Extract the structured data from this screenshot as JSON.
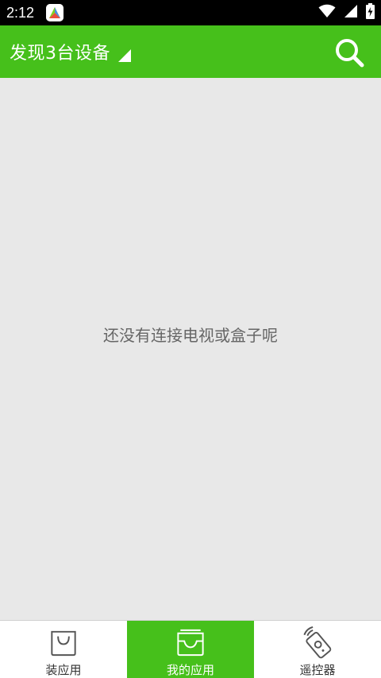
{
  "status_bar": {
    "time": "2:12",
    "icons": [
      "app-notification-icon",
      "wifi-icon",
      "cell-signal-icon",
      "battery-charging-icon"
    ]
  },
  "app_bar": {
    "title": "发现3台设备",
    "dropdown_icon": "triangle-dropdown-icon",
    "search_icon": "search-icon"
  },
  "main": {
    "empty_message": "还没有连接电视或盒子呢"
  },
  "bottom_nav": {
    "items": [
      {
        "label": "装应用",
        "icon": "shopping-bag-icon",
        "active": false
      },
      {
        "label": "我的应用",
        "icon": "inbox-tray-icon",
        "active": true
      },
      {
        "label": "遥控器",
        "icon": "remote-control-icon",
        "active": false
      }
    ]
  },
  "colors": {
    "accent": "#46c01b",
    "background": "#e8e8e8",
    "status_bar": "#000000",
    "empty_text": "#666666"
  }
}
